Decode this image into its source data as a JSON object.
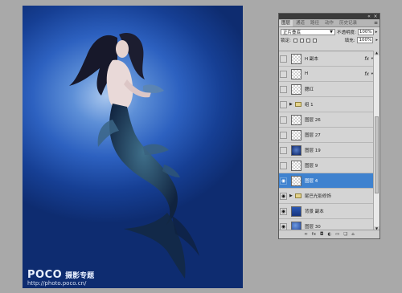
{
  "watermark": {
    "brand": "POCO",
    "subtitle": "摄影专题",
    "url": "http://photo.poco.cn/"
  },
  "panel": {
    "tabs": [
      "图层",
      "通道",
      "路径",
      "动作",
      "历史记录"
    ],
    "blend_mode": "正片叠底",
    "opacity_label": "不透明度:",
    "opacity_value": "100%",
    "lock_label": "锁定:",
    "fill_label": "填充:",
    "fill_value": "100%",
    "layers": [
      {
        "name": "H 副本",
        "fx": "fx",
        "visible": false
      },
      {
        "name": "H",
        "fx": "fx",
        "visible": false
      },
      {
        "name": "腮红",
        "visible": false
      },
      {
        "name": "组 1",
        "group": true,
        "visible": false
      },
      {
        "name": "图层 26",
        "visible": false
      },
      {
        "name": "图层 27",
        "visible": false
      },
      {
        "name": "图层 19",
        "visible": false
      },
      {
        "name": "图层 9",
        "visible": false
      },
      {
        "name": "图层 4",
        "visible": true,
        "selected": true
      },
      {
        "name": "尾巴光影修饰",
        "group": true,
        "visible": true
      },
      {
        "name": "背景 副本",
        "visible": true
      },
      {
        "name": "图层 30",
        "visible": true
      }
    ]
  },
  "colors": {
    "selection": "#3f82cf",
    "background_blue": "#2d61c0"
  }
}
